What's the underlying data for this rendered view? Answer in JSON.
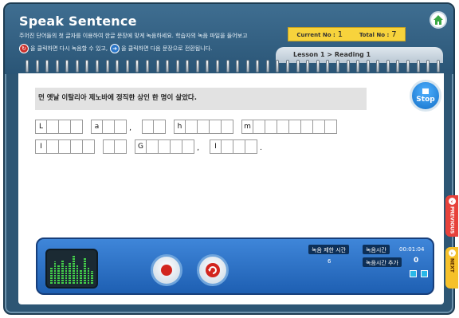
{
  "app": {
    "title": "Speak Sentence",
    "instruction_line1": "주어진 단어들의 첫 글자를 이용하여 한글 문장에 맞게 녹음하세요. 학습자의 녹음 파일을 들어보고",
    "instruction_line2a": "을 클릭하면 다시 녹음할 수 있고,",
    "instruction_line2b": "을 클릭하면 다음 문장으로 전환됩니다."
  },
  "counter": {
    "current_label": "Current No :",
    "current_value": "1",
    "total_label": "Total No :",
    "total_value": "7"
  },
  "breadcrumb": "Lesson 1 > Reading 1",
  "sentence": "먼 옛날 이탈리아 제노바에 정직한 상인 한 명이 살았다.",
  "stop_label": "Stop",
  "answer_rows": [
    [
      {
        "letter": "L",
        "cells": 4
      },
      {
        "letter": "a",
        "cells": 3,
        "after": ","
      },
      {
        "letter": "",
        "cells": 2
      },
      {
        "letter": "h",
        "cells": 5
      },
      {
        "letter": "m",
        "cells": 8
      }
    ],
    [
      {
        "letter": "I",
        "cells": 5
      },
      {
        "letter": "",
        "cells": 2
      },
      {
        "letter": "G",
        "cells": 5,
        "after": ","
      },
      {
        "letter": "I",
        "cells": 4,
        "after": "."
      }
    ]
  ],
  "controls": {
    "record_limit_label": "녹음 제한 시간",
    "record_limit_value": "6",
    "record_time_label": "녹음시간",
    "record_time_value": "00:01:04",
    "add_time_label": "녹음시간 추가",
    "add_time_value": "0"
  },
  "side_tabs": {
    "previous": "PREVIOUS",
    "next": "NEXT"
  },
  "meter_levels": [
    0.5,
    0.7,
    0.6,
    0.75,
    0.55,
    0.65,
    0.9,
    0.6,
    0.45,
    0.8,
    0.5,
    0.4
  ],
  "colors": {
    "frame": "#2d5674",
    "counter_bg": "#f7d33c",
    "control_bar": "#2a6fc8",
    "prev_tab": "#e7423b",
    "next_tab": "#f6c12a"
  },
  "icons": [
    "home-icon",
    "record-icon",
    "rerecord-icon",
    "previous-icon",
    "next-icon",
    "arrow-down-icon",
    "arrow-up-icon"
  ]
}
